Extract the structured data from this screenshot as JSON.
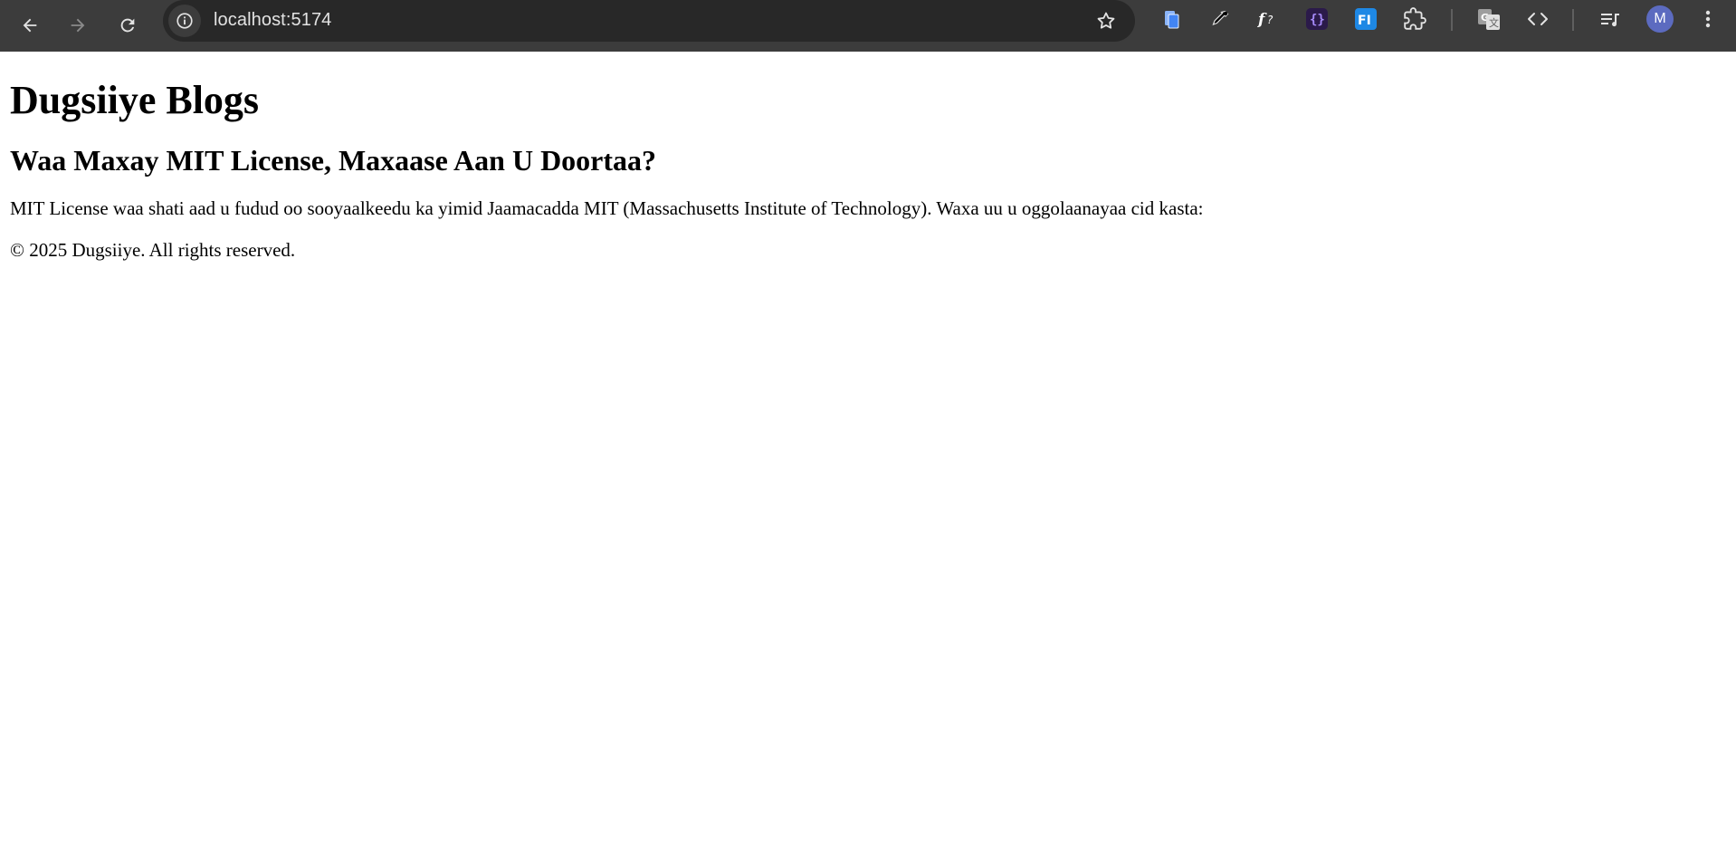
{
  "browser": {
    "url": "localhost:5174",
    "avatar_initial": "M",
    "colors": {
      "toolbar": "#3c3c3c",
      "omnibox": "#282828",
      "icon": "#e3e3e3",
      "avatar": "#5c6bc0"
    },
    "nav_icons": [
      "back-icon",
      "forward-icon",
      "reload-icon"
    ],
    "extension_icons": [
      "docs-extension-icon",
      "color-picker-extension-icon",
      "font-extension-icon",
      "json-extension-icon",
      "fi-extension-icon",
      "extensions-puzzle-icon",
      "google-translate-icon",
      "code-view-icon",
      "media-playlist-icon",
      "more-menu-icon"
    ]
  },
  "page": {
    "site_title": "Dugsiiye Blogs",
    "post_title": "Waa Maxay MIT License, Maxaase Aan U Doortaa?",
    "post_body": "MIT License waa shati aad u fudud oo sooyaalkeedu ka yimid Jaamacadda MIT (Massachusetts Institute of Technology). Waxa uu u oggolaanayaa cid kasta:",
    "footer": "© 2025 Dugsiiye. All rights reserved."
  }
}
